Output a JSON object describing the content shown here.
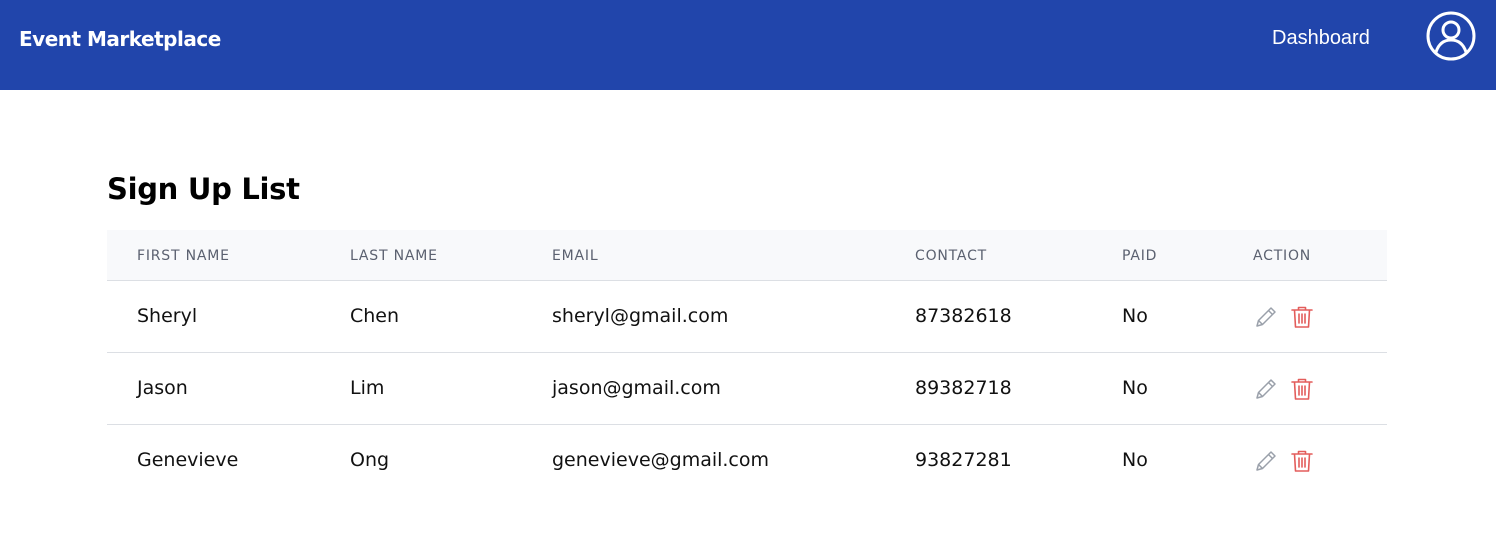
{
  "header": {
    "brand": "Event Marketplace",
    "nav_dashboard": "Dashboard",
    "avatar_icon": "user-circle-icon"
  },
  "main": {
    "title": "Sign Up List"
  },
  "table": {
    "columns": [
      "FIRST NAME",
      "LAST NAME",
      "EMAIL",
      "CONTACT",
      "PAID",
      "ACTION"
    ],
    "rows": [
      {
        "first_name": "Sheryl",
        "last_name": "Chen",
        "email": "sheryl@gmail.com",
        "contact": "87382618",
        "paid": "No"
      },
      {
        "first_name": "Jason",
        "last_name": "Lim",
        "email": "jason@gmail.com",
        "contact": "89382718",
        "paid": "No"
      },
      {
        "first_name": "Genevieve",
        "last_name": "Ong",
        "email": "genevieve@gmail.com",
        "contact": "93827281",
        "paid": "No"
      }
    ],
    "action_icons": {
      "edit": "pencil-icon",
      "delete": "trash-icon"
    }
  },
  "colors": {
    "header_bg": "#2145ab",
    "edit_icon": "#9aa0aa",
    "delete_icon": "#e35d5b",
    "table_header_bg": "#f8f9fb"
  }
}
